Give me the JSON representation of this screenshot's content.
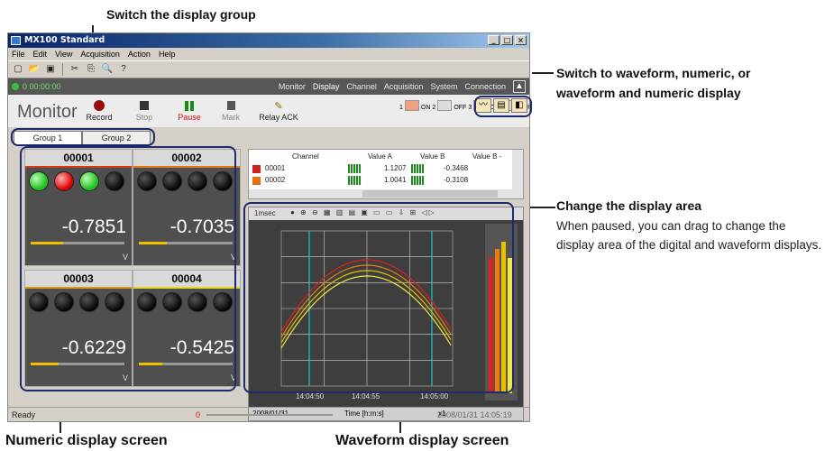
{
  "callouts": {
    "group": "Switch the display group",
    "view": "Switch to waveform, numeric, or waveform and numeric display",
    "area_title": "Change the display area",
    "area_desc": "When paused, you can drag to change the display area of the digital and waveform displays.",
    "numeric": "Numeric display screen",
    "waveform": "Waveform display screen"
  },
  "window": {
    "title": "MX100 Standard",
    "menu": [
      "File",
      "Edit",
      "View",
      "Acquisition",
      "Action",
      "Help"
    ],
    "elapsed": "0 00:00:00",
    "nav": [
      "Monitor",
      "Display",
      "Channel",
      "Acquisition",
      "System",
      "Connection"
    ],
    "page_title": "Monitor",
    "controls": {
      "record": "Record",
      "stop": "Stop",
      "pause": "Pause",
      "mark": "Mark",
      "relay": "Relay ACK"
    },
    "switches": [
      {
        "num": "1",
        "state": "ON"
      },
      {
        "num": "2",
        "state": "OFF"
      },
      {
        "num": "3",
        "state": "ON"
      },
      {
        "num": "4",
        "state": "OFF"
      }
    ],
    "groups": [
      "Group 1",
      "Group 2"
    ],
    "status": "Ready",
    "status_zero": "0",
    "datetime": "2008/01/31 14:05:19"
  },
  "tiles": [
    {
      "id": "00001",
      "value": "-0.7851",
      "unit": "V",
      "line": "#d23a1a",
      "leds": [
        "green",
        "red",
        "green",
        "off"
      ],
      "level": 0.35
    },
    {
      "id": "00002",
      "value": "-0.7035",
      "unit": "V",
      "line": "#e07a10",
      "leds": [
        "off",
        "off",
        "off",
        "off"
      ],
      "level": 0.3
    },
    {
      "id": "00003",
      "value": "-0.6229",
      "unit": "V",
      "line": "#d8a010",
      "leds": [
        "off",
        "off",
        "off",
        "off"
      ],
      "level": 0.3
    },
    {
      "id": "00004",
      "value": "-0.5425",
      "unit": "V",
      "line": "#e8d820",
      "leds": [
        "off",
        "off",
        "off",
        "off"
      ],
      "level": 0.25
    }
  ],
  "table": {
    "headers": [
      "Channel",
      "Value A",
      "Value B",
      "Value B -"
    ],
    "rows": [
      {
        "channel": "00001",
        "a": "1.1207",
        "b": "-0.3468",
        "color": "#d02020"
      },
      {
        "channel": "00002",
        "a": "1.0041",
        "b": "-0.3108",
        "color": "#e07010"
      }
    ]
  },
  "waveform": {
    "unit_label": "1msec",
    "x_ticks": [
      "14:04:50",
      "14:04:55",
      "14:05:00"
    ],
    "x_label": "Time [h:m:s]",
    "date": "2008/01/31",
    "zoom": "x1"
  },
  "colors": {
    "outline": "#1e2a6e",
    "grid": "#cfcfcf",
    "trace1": "#e02020",
    "trace2": "#f07a10",
    "trace3": "#e8c000",
    "trace4": "#f5e640",
    "cursor": "#19c6c6"
  }
}
